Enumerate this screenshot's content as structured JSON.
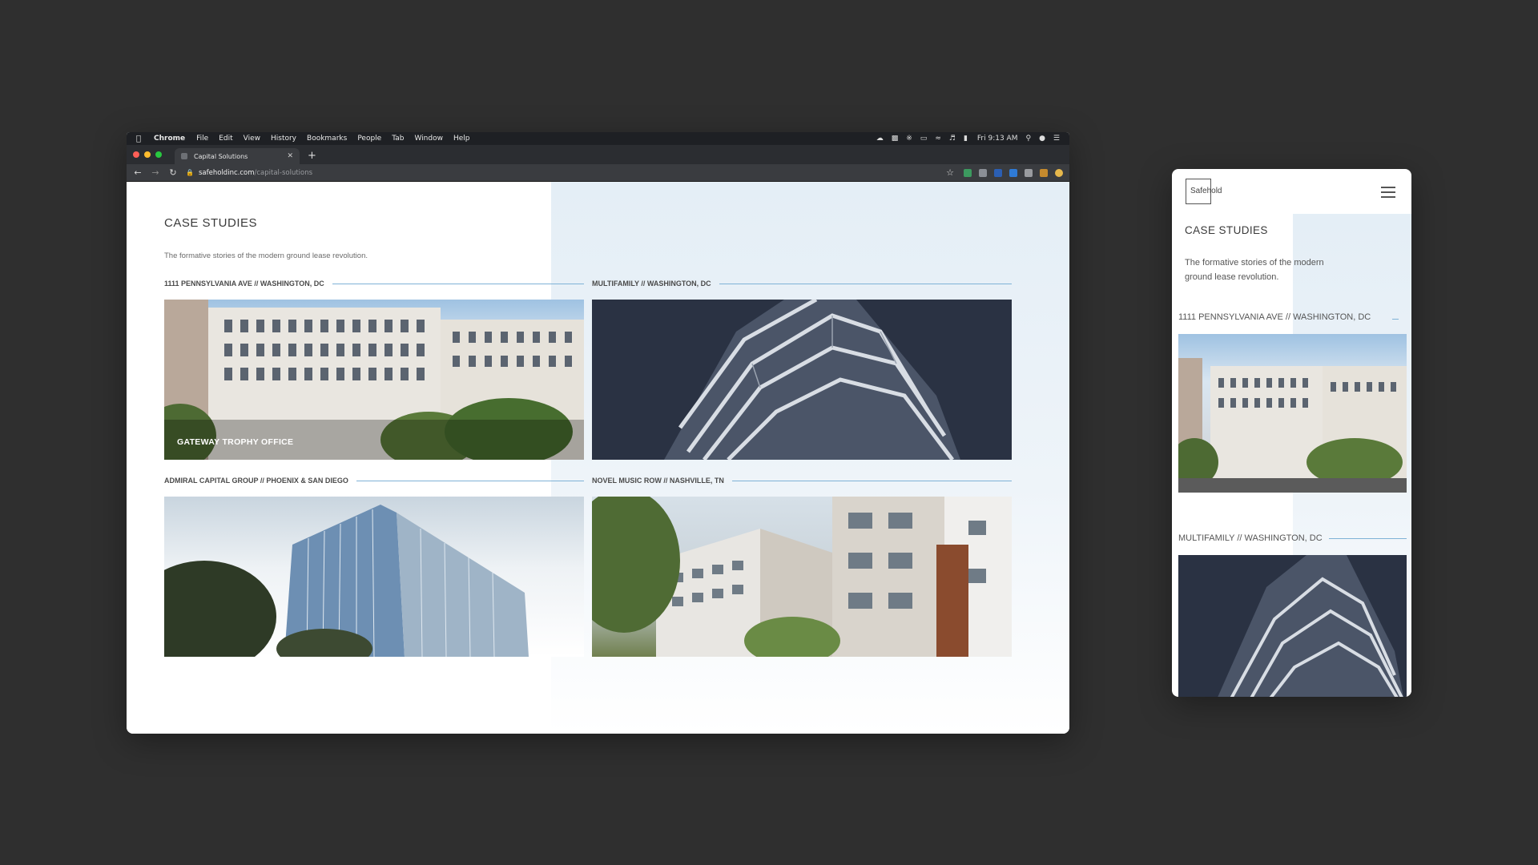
{
  "menubar": {
    "app_name": "Chrome",
    "items": [
      "File",
      "Edit",
      "View",
      "History",
      "Bookmarks",
      "People",
      "Tab",
      "Window",
      "Help"
    ],
    "clock": "Fri 9:13 AM"
  },
  "tab": {
    "title": "Capital Solutions"
  },
  "address": {
    "host": "safeholdinc.com",
    "path": "/capital-solutions"
  },
  "page": {
    "heading": "CASE STUDIES",
    "intro": "The formative stories of the modern ground lease revolution.",
    "studies": [
      {
        "label": "1111 PENNSYLVANIA AVE  //  WASHINGTON, DC",
        "caption": "GATEWAY TROPHY OFFICE"
      },
      {
        "label": "MULTIFAMILY // WASHINGTON, DC",
        "caption": ""
      },
      {
        "label": "ADMIRAL CAPITAL GROUP // PHOENIX & SAN DIEGO",
        "caption": ""
      },
      {
        "label": "NOVEL MUSIC ROW // NASHVILLE, TN",
        "caption": ""
      }
    ]
  },
  "mobile": {
    "logo_text": "Safehold",
    "heading": "CASE STUDIES",
    "intro": "The formative stories of the modern ground lease revolution.",
    "studies": [
      {
        "label": "1111 PENNSYLVANIA AVE  //  WASHINGTON, DC"
      },
      {
        "label": "MULTIFAMILY // WASHINGTON, DC"
      }
    ]
  },
  "colors": {
    "accent_line": "#7fb2d6",
    "page_tint": "#e4eef6",
    "backdrop": "#2f2f2f"
  }
}
